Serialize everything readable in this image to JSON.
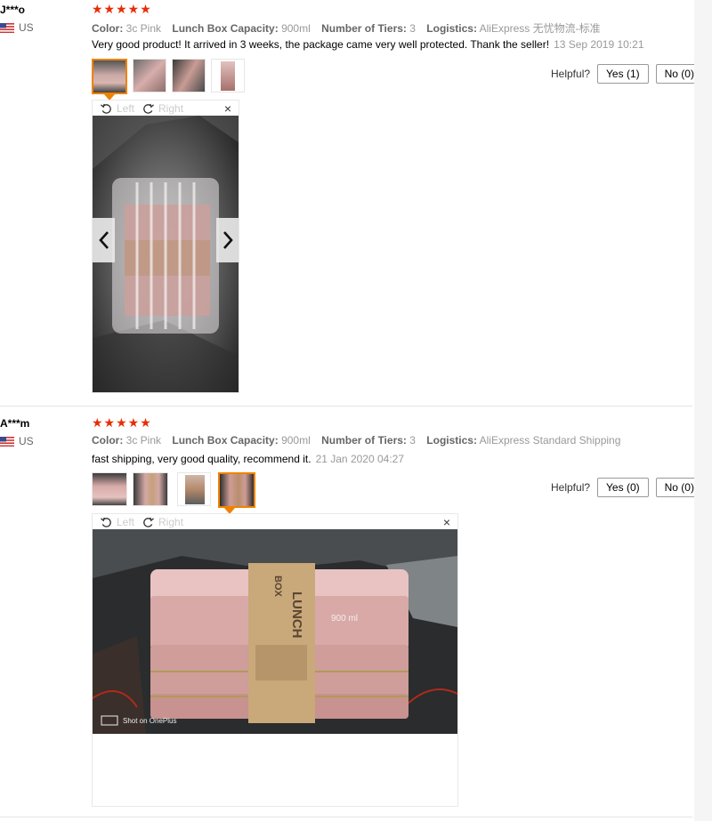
{
  "feedbacks": [
    {
      "user": "J***o",
      "country": "US",
      "stars": "★★★★★",
      "attrs": [
        {
          "label": "Color:",
          "value": "3c Pink"
        },
        {
          "label": "Lunch Box Capacity:",
          "value": "900ml"
        },
        {
          "label": "Number of Tiers:",
          "value": "3"
        },
        {
          "label": "Logistics:",
          "value": "AliExpress 无忧物流-标准"
        }
      ],
      "text": "Very good product! It arrived in 3 weeks, the package came very well protected. Thank the seller!",
      "date": "13 Sep 2019 10:21",
      "helpful_label": "Helpful?",
      "yes_label": "Yes (1)",
      "no_label": "No (0)",
      "viewer": {
        "left_label": "Left",
        "right_label": "Right",
        "close": "×"
      }
    },
    {
      "user": "A***m",
      "country": "US",
      "stars": "★★★★★",
      "attrs": [
        {
          "label": "Color:",
          "value": "3c Pink"
        },
        {
          "label": "Lunch Box Capacity:",
          "value": "900ml"
        },
        {
          "label": "Number of Tiers:",
          "value": "3"
        },
        {
          "label": "Logistics:",
          "value": "AliExpress Standard Shipping"
        }
      ],
      "text": "fast shipping, very good quality, recommend it.",
      "date": "21 Jan 2020 04:27",
      "helpful_label": "Helpful?",
      "yes_label": "Yes (0)",
      "no_label": "No (0)",
      "viewer": {
        "left_label": "Left",
        "right_label": "Right",
        "close": "×"
      },
      "photo_text": {
        "band_line1": "LUNCH",
        "band_line2": "BOX",
        "capacity": "900 ml",
        "watermark": "Shot on OnePlus"
      }
    }
  ],
  "colors": {
    "star": "#e62e04",
    "active_thumb": "#f08200",
    "muted": "#999999"
  }
}
